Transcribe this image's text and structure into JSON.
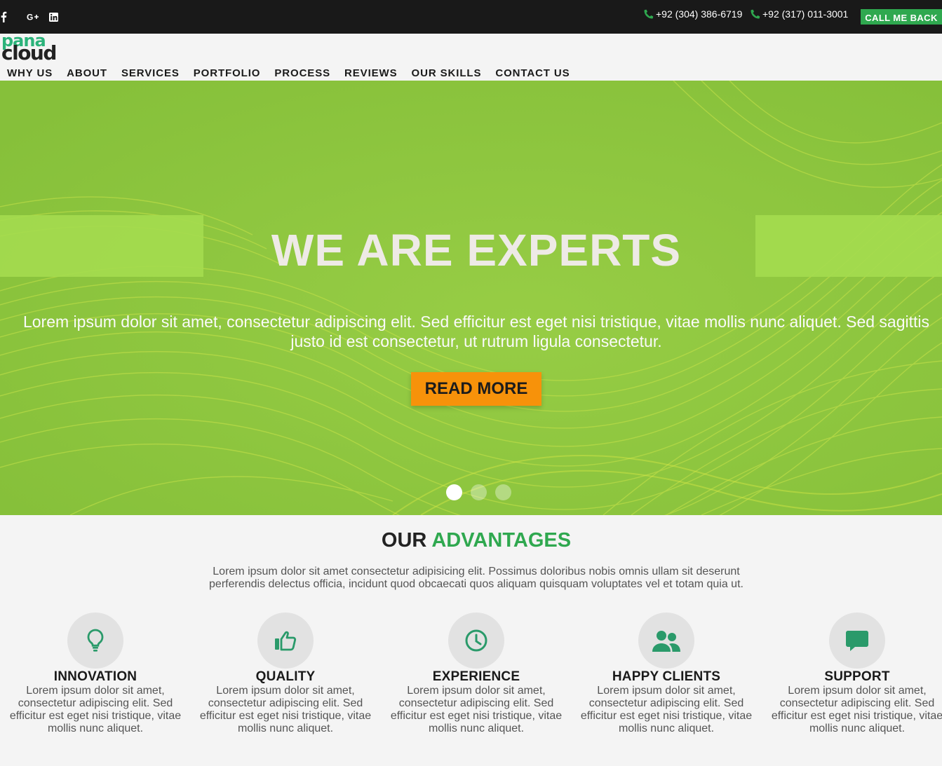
{
  "topbar": {
    "social": [
      {
        "name": "facebook-icon"
      },
      {
        "name": "google-plus-icon"
      },
      {
        "name": "linkedin-icon"
      }
    ],
    "phones": [
      "+92 (304) 386-6719",
      "+92 (317) 011-3001"
    ],
    "callback_label": "CALL ME BACK"
  },
  "header": {
    "logo_top": "pana",
    "logo_bottom": "cloud",
    "nav": [
      "WHY US",
      "ABOUT",
      "SERVICES",
      "PORTFOLIO",
      "PROCESS",
      "REVIEWS",
      "OUR SKILLS",
      "CONTACT US"
    ]
  },
  "hero": {
    "title": "WE ARE EXPERTS",
    "text": "Lorem ipsum dolor sit amet, consectetur adipiscing elit. Sed efficitur est eget nisi tristique, vitae mollis nunc aliquet. Sed sagittis justo id est consectetur, ut rutrum ligula consectetur.",
    "button_label": "READ MORE",
    "slide_count": 3,
    "active_slide": 1
  },
  "advantages": {
    "title_plain": "OUR",
    "title_accent": "ADVANTAGES",
    "subtitle": "Lorem ipsum dolor sit amet consectetur adipisicing elit. Possimus doloribus nobis omnis ullam sit deserunt perferendis delectus officia, incidunt quod obcaecati quos aliquam quisquam voluptates vel et totam quia ut.",
    "items": [
      {
        "icon": "lightbulb-icon",
        "heading": "INNOVATION",
        "body": "Lorem ipsum dolor sit amet, consectetur adipiscing elit. Sed efficitur est eget nisi tristique, vitae mollis nunc aliquet."
      },
      {
        "icon": "thumbs-up-icon",
        "heading": "QUALITY",
        "body": "Lorem ipsum dolor sit amet, consectetur adipiscing elit. Sed efficitur est eget nisi tristique, vitae mollis nunc aliquet."
      },
      {
        "icon": "clock-icon",
        "heading": "EXPERIENCE",
        "body": "Lorem ipsum dolor sit amet, consectetur adipiscing elit. Sed efficitur est eget nisi tristique, vitae mollis nunc aliquet."
      },
      {
        "icon": "users-icon",
        "heading": "HAPPY CLIENTS",
        "body": "Lorem ipsum dolor sit amet, consectetur adipiscing elit. Sed efficitur est eget nisi tristique, vitae mollis nunc aliquet."
      },
      {
        "icon": "chat-bubble-icon",
        "heading": "SUPPORT",
        "body": "Lorem ipsum dolor sit amet, consectetur adipiscing elit. Sed efficitur est eget nisi tristique, vitae mollis nunc aliquet."
      }
    ]
  },
  "colors": {
    "topbar_bg": "#191919",
    "accent_green": "#2fa84f",
    "hero_green": "#8ec63f",
    "cta_orange": "#f7920a",
    "icon_green": "#2a9a6a"
  }
}
